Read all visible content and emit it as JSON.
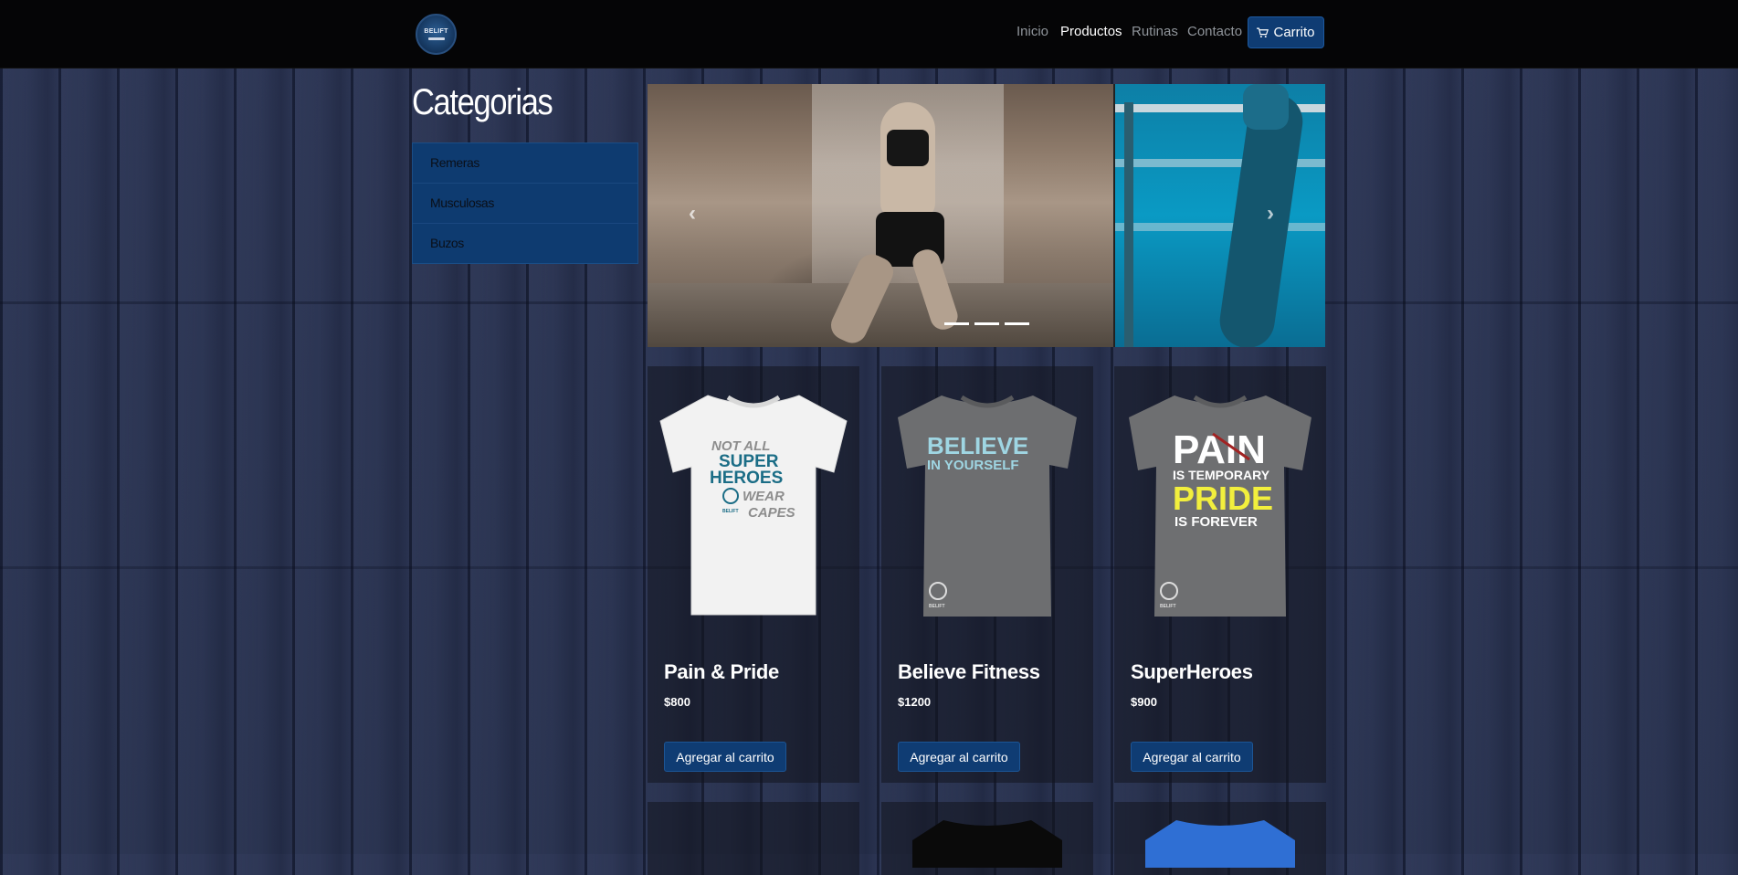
{
  "brand": {
    "logo_text": "BELIFT"
  },
  "nav": {
    "links": [
      "Inicio",
      "Productos",
      "Rutinas",
      "Contacto"
    ],
    "active": "Productos",
    "cart_label": "Carrito",
    "cart_icon": "cart-icon"
  },
  "sidebar": {
    "title": "Categorias",
    "items": [
      "Remeras",
      "Musculosas",
      "Buzos"
    ]
  },
  "carousel": {
    "slides": 3,
    "active_index": 0,
    "prev_icon": "chevron-left-icon",
    "next_icon": "chevron-right-icon"
  },
  "products": [
    {
      "name": "Pain & Pride",
      "price": "$800",
      "button": "Agregar al carrito",
      "shirt_color": "#f2f2f2",
      "print": [
        "NOT ALL",
        "SUPER",
        "HEROES",
        "WEAR",
        "CAPES",
        "BELIFT"
      ]
    },
    {
      "name": "Believe Fitness",
      "price": "$1200",
      "button": "Agregar al carrito",
      "shirt_color": "#6d6e70",
      "print": [
        "BELIEVE",
        "IN YOURSELF",
        "BELIFT"
      ]
    },
    {
      "name": "SuperHeroes",
      "price": "$900",
      "button": "Agregar al carrito",
      "shirt_color": "#6e6f71",
      "print": [
        "PAIN",
        "IS TEMPORARY",
        "PRIDE",
        "IS FOREVER",
        "BELIFT"
      ]
    }
  ],
  "colors": {
    "accent": "#0f3c73",
    "navbar": "#050506",
    "background": "#2a3350",
    "pride_yellow": "#f2ef3d",
    "heroes_teal": "#1b6d86"
  }
}
